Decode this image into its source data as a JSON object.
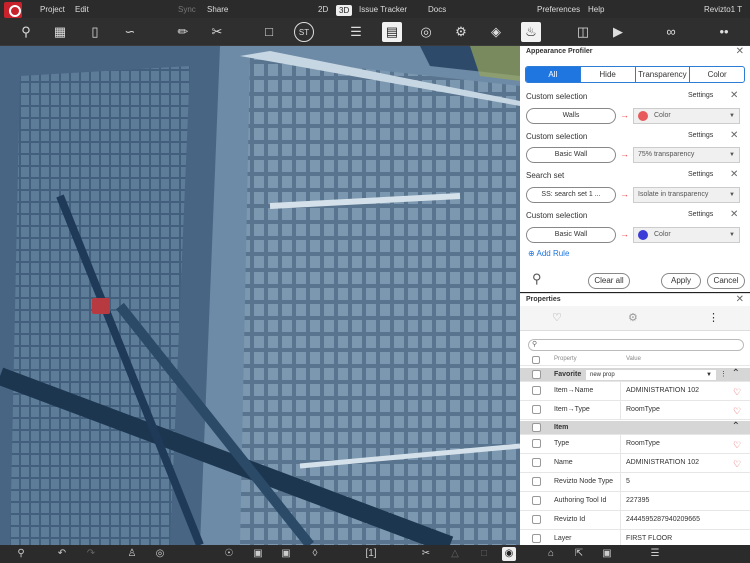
{
  "menu": {
    "project": "Project",
    "edit": "Edit",
    "sync": "Sync",
    "share": "Share",
    "view_2d": "2D",
    "view_3d": "3D",
    "issue_tracker": "Issue Tracker",
    "docs": "Docs",
    "preferences": "Preferences",
    "help": "Help",
    "user": "Revizto1 T"
  },
  "toolbar": {
    "icons": [
      "location-pin-icon",
      "map-icon",
      "door-icon",
      "path-icon",
      "ruler-icon",
      "scissors-icon",
      "comment-icon",
      "st-icon",
      "layers-icon",
      "list-icon",
      "camera-icon",
      "settings-icon",
      "tag-icon",
      "paint-bucket-icon",
      "chat-icon",
      "video-icon",
      "link-icon",
      "more-icon"
    ],
    "st_label": "ST"
  },
  "appearance_profiler": {
    "title": "Appearance Profiler",
    "tabs": [
      "All",
      "Hide",
      "Transparency",
      "Color"
    ],
    "settings_label": "Settings",
    "rules": [
      {
        "title": "Custom selection",
        "target": "Walls",
        "action": "Color",
        "color": "#e85a5a"
      },
      {
        "title": "Custom selection",
        "target": "Basic Wall",
        "action": "75% transparency",
        "color": null
      },
      {
        "title": "Search set",
        "target": "SS: search set 1 ...",
        "action": "Isolate in transparency",
        "color": null
      },
      {
        "title": "Custom selection",
        "target": "Basic Wall",
        "action": "Color",
        "color": "#3b3bd8"
      }
    ],
    "add_rule": "Add Rule",
    "clear_all": "Clear all",
    "apply": "Apply",
    "cancel": "Cancel"
  },
  "properties": {
    "title": "Properties",
    "search_placeholder": "",
    "col_property": "Property",
    "col_value": "Value",
    "favorite_group": "Favorite",
    "new_prop": "new prop",
    "item_group": "Item",
    "favorite_rows": [
      {
        "name": "Item→Name",
        "value": "ADMINISTRATION 102",
        "fav": true
      },
      {
        "name": "Item→Type",
        "value": "RoomType",
        "fav": true
      }
    ],
    "item_rows": [
      {
        "name": "Type",
        "value": "RoomType",
        "fav": true
      },
      {
        "name": "Name",
        "value": "ADMINISTRATION 102",
        "fav": true
      },
      {
        "name": "Revizto Node Type",
        "value": "5",
        "fav": false
      },
      {
        "name": "Authoring Tool Id",
        "value": "227395",
        "fav": false
      },
      {
        "name": "Revizto Id",
        "value": "2444595287940209665",
        "fav": false
      },
      {
        "name": "Layer",
        "value": "FIRST FLOOR",
        "fav": false
      }
    ]
  },
  "bottombar": {
    "page_indicator": "[1]"
  }
}
